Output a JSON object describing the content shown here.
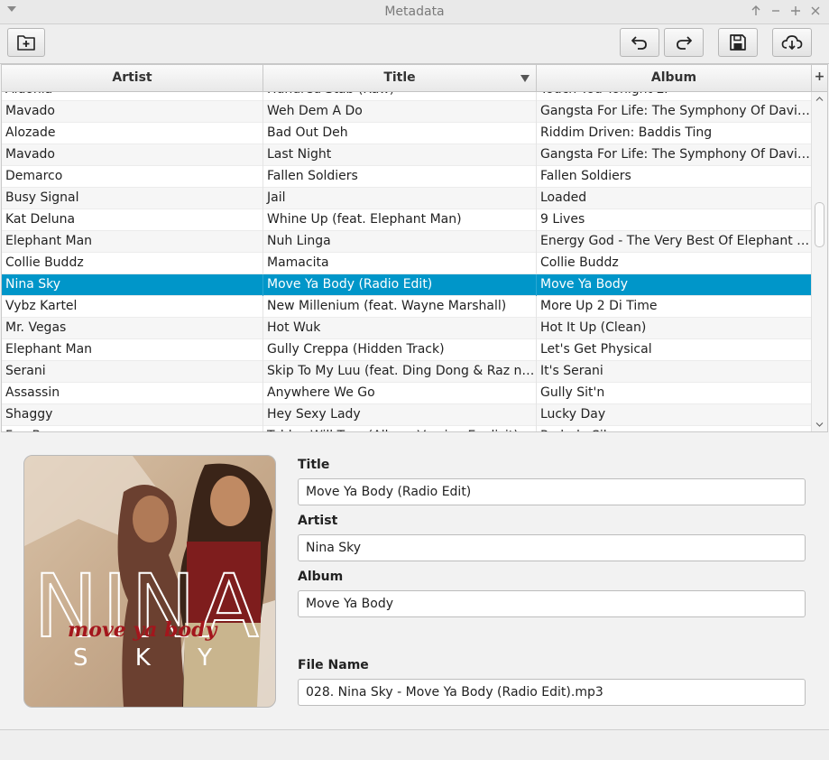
{
  "window": {
    "title": "Metadata"
  },
  "table": {
    "columns": [
      "Artist",
      "Title",
      "Album"
    ],
    "sorted_column": "Title",
    "add_column_symbol": "+",
    "rows": [
      {
        "artist": "Aidonia",
        "title": "Hundred Stab (Raw)",
        "album": "Touch You Tonight EP"
      },
      {
        "artist": "Mavado",
        "title": "Weh Dem A Do",
        "album": "Gangsta For Life: The Symphony Of David Br..."
      },
      {
        "artist": "Alozade",
        "title": "Bad Out Deh",
        "album": "Riddim Driven: Baddis Ting"
      },
      {
        "artist": "Mavado",
        "title": "Last Night",
        "album": "Gangsta For Life: The Symphony Of David Br..."
      },
      {
        "artist": "Demarco",
        "title": "Fallen Soldiers",
        "album": "Fallen Soldiers"
      },
      {
        "artist": "Busy Signal",
        "title": "Jail",
        "album": "Loaded"
      },
      {
        "artist": "Kat Deluna",
        "title": "Whine Up (feat. Elephant Man)",
        "album": "9 Lives"
      },
      {
        "artist": "Elephant Man",
        "title": "Nuh Linga",
        "album": "Energy God - The Very Best Of Elephant Man"
      },
      {
        "artist": "Collie Buddz",
        "title": "Mamacita",
        "album": "Collie Buddz"
      },
      {
        "artist": "Nina Sky",
        "title": "Move Ya Body (Radio Edit)",
        "album": "Move Ya Body",
        "selected": true
      },
      {
        "artist": "Vybz Kartel",
        "title": "New Millenium (feat. Wayne Marshall)",
        "album": "More Up 2 Di Time"
      },
      {
        "artist": "Mr. Vegas",
        "title": "Hot Wuk",
        "album": "Hot It Up (Clean)"
      },
      {
        "artist": "Elephant Man",
        "title": "Gully Creppa (Hidden Track)",
        "album": "Let's Get Physical"
      },
      {
        "artist": "Serani",
        "title": "Skip To My Luu (feat. Ding Dong & Raz n Big...",
        "album": "It's Serani"
      },
      {
        "artist": "Assassin",
        "title": "Anywhere We Go",
        "album": "Gully Sit'n"
      },
      {
        "artist": "Shaggy",
        "title": "Hey Sexy Lady",
        "album": "Lucky Day"
      },
      {
        "artist": "Fun Boy",
        "title": "Tables Will Turn (Album Version Explicit)",
        "album": "Prelude Silence"
      }
    ]
  },
  "details": {
    "title_label": "Title",
    "title_value": "Move Ya Body (Radio Edit)",
    "artist_label": "Artist",
    "artist_value": "Nina Sky",
    "album_label": "Album",
    "album_value": "Move Ya Body",
    "filename_label": "File Name",
    "filename_value": "028. Nina Sky - Move Ya Body (Radio Edit).mp3"
  },
  "album_art": {
    "big_text": "NINA",
    "subtitle": "move ya body",
    "small_text": "S K Y"
  },
  "colors": {
    "selection": "#0096c9",
    "art_subtitle": "#a3161c"
  }
}
